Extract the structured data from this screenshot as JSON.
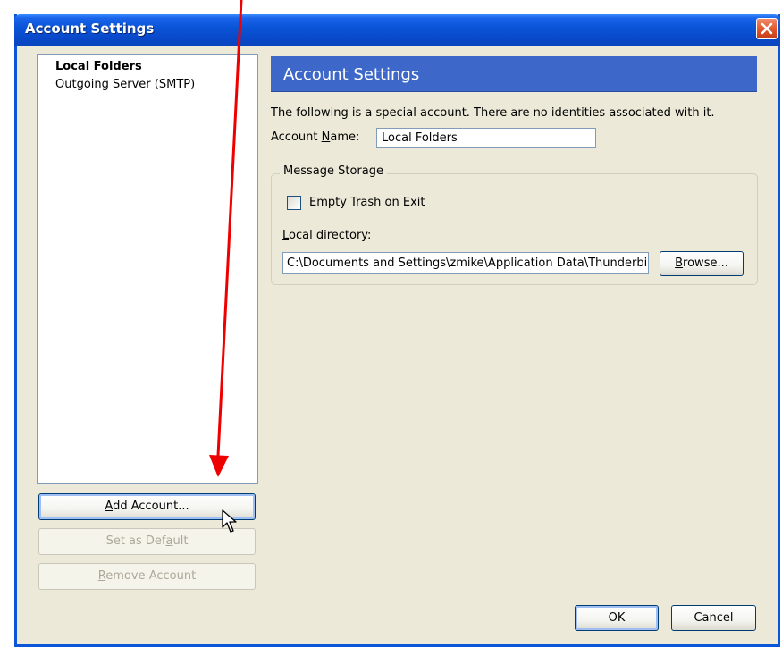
{
  "window": {
    "title": "Account Settings"
  },
  "account_list": {
    "items": [
      {
        "label": "Local Folders",
        "selected": true
      },
      {
        "label": "Outgoing Server (SMTP)",
        "selected": false
      }
    ]
  },
  "buttons": {
    "add_account": {
      "pre": "",
      "u": "A",
      "post": "dd Account..."
    },
    "set_default": {
      "pre": "Set as Def",
      "u": "a",
      "post": "ult"
    },
    "remove_account": {
      "pre": "",
      "u": "R",
      "post": "emove Account"
    },
    "browse": {
      "pre": "",
      "u": "B",
      "post": "rowse..."
    },
    "ok": "OK",
    "cancel": "Cancel"
  },
  "panel": {
    "header": "Account Settings",
    "intro": "The following is a special account. There are no identities associated with it.",
    "account_name_label": {
      "pre": "Account ",
      "u": "N",
      "post": "ame:"
    },
    "account_name_value": "Local Folders",
    "message_storage": {
      "legend": "Message Storage",
      "empty_trash_label": "Empty Trash on Exit",
      "empty_trash_checked": false,
      "local_dir_label": {
        "pre": "",
        "u": "L",
        "post": "ocal directory:"
      },
      "local_dir_value": "C:\\Documents and Settings\\zmike\\Application Data\\Thunderbird"
    }
  },
  "colors": {
    "title_bar": "#0a55d8",
    "panel_header": "#3d68c9",
    "dialog_bg": "#ece9d8",
    "annotation_arrow": "#ee0000"
  }
}
